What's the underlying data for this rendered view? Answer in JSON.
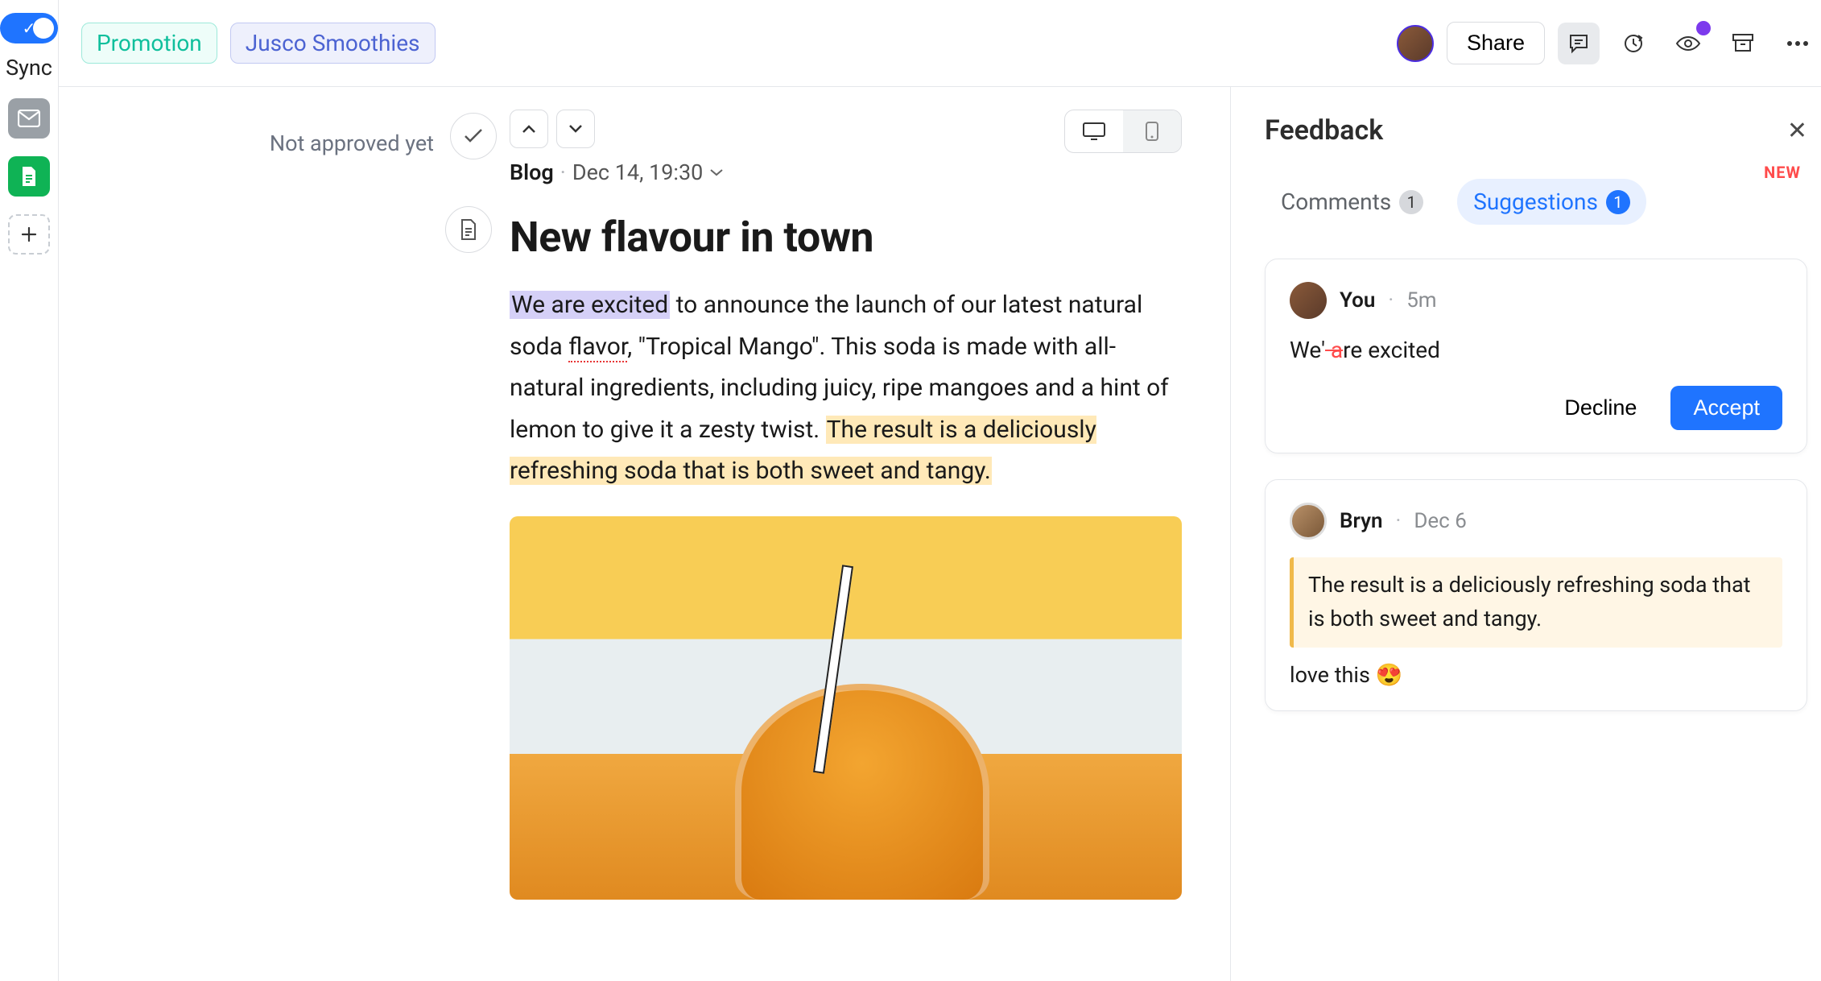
{
  "rail": {
    "sync_label": "Sync"
  },
  "header": {
    "tags": {
      "promotion": "Promotion",
      "brand": "Jusco Smoothies"
    },
    "share_label": "Share"
  },
  "approval": {
    "status": "Not approved yet"
  },
  "post": {
    "category": "Blog",
    "datetime": "Dec 14, 19:30",
    "title": "New flavour in town",
    "body_highlight_blue": "We are excited",
    "body_part1": " to announce the launch of our latest natural soda ",
    "body_spellcheck": "flavor",
    "body_part2": ", \"Tropical Mango\". This soda is made with all-natural ingredients, including juicy, ripe mangoes and a hint of lemon to give it a zesty twist. ",
    "body_highlight_yellow": "The result is a deliciously refreshing soda that is both sweet and tangy."
  },
  "panel": {
    "title": "Feedback",
    "tabs": {
      "comments_label": "Comments",
      "comments_count": "1",
      "suggestions_label": "Suggestions",
      "suggestions_count": "1",
      "new_badge": "NEW"
    },
    "suggestion": {
      "author": "You",
      "time": "5m",
      "text_before": "We",
      "text_strike": " a",
      "text_after": "re excited",
      "decline_label": "Decline",
      "accept_label": "Accept"
    },
    "comment": {
      "author": "Bryn",
      "time": "Dec 6",
      "quote": "The result is a deliciously refreshing soda that is both sweet and tangy.",
      "text": "love this 😍"
    }
  }
}
